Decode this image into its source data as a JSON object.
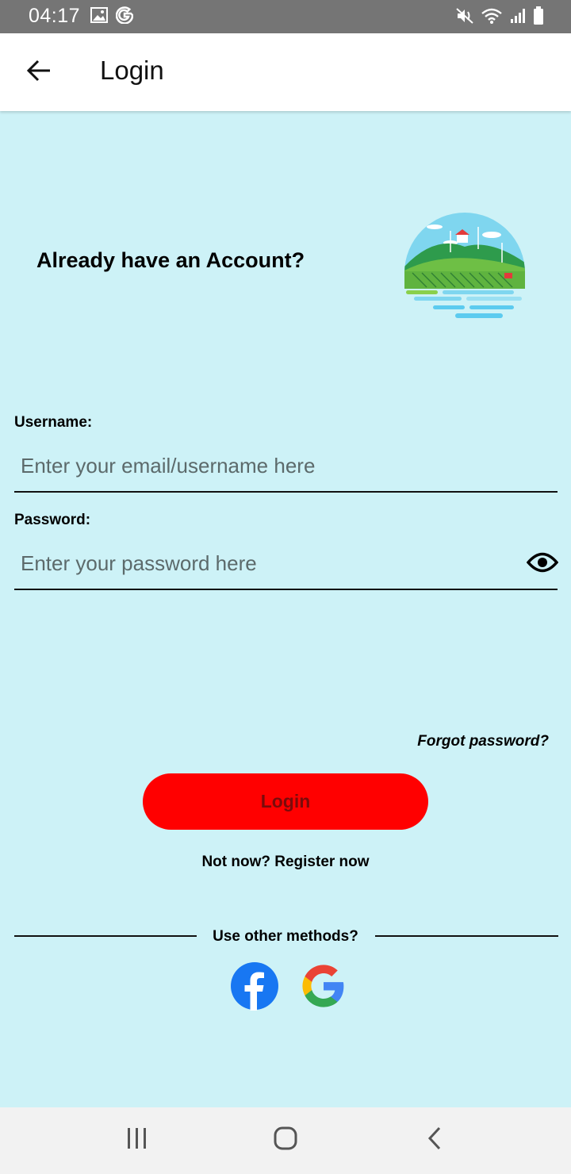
{
  "status_bar": {
    "time": "04:17",
    "icons_left": [
      "gallery-icon",
      "google-g-icon"
    ],
    "icons_right": [
      "mute-icon",
      "wifi-icon",
      "signal-icon",
      "battery-icon"
    ]
  },
  "app_bar": {
    "title": "Login",
    "back_icon": "arrow-left-icon"
  },
  "hero": {
    "heading": "Already have an Account?",
    "illustration": "farm-landscape-illustration"
  },
  "form": {
    "username": {
      "label": "Username:",
      "placeholder": "Enter your email/username here",
      "value": ""
    },
    "password": {
      "label": "Password:",
      "placeholder": "Enter your password here",
      "value": "",
      "toggle_icon": "eye-icon"
    }
  },
  "actions": {
    "forgot_password": "Forgot password?",
    "login_label": "Login",
    "register_prompt": "Not now? Register now"
  },
  "other_methods": {
    "label": "Use other methods?",
    "providers": [
      "facebook-icon",
      "google-icon"
    ]
  },
  "colors": {
    "background": "#cdf2f7",
    "login_button": "#ff0000",
    "login_text": "#7a0b0b",
    "status_bar": "#757575"
  },
  "nav_bar": {
    "buttons": [
      "recent-apps-icon",
      "home-icon",
      "back-icon"
    ]
  }
}
